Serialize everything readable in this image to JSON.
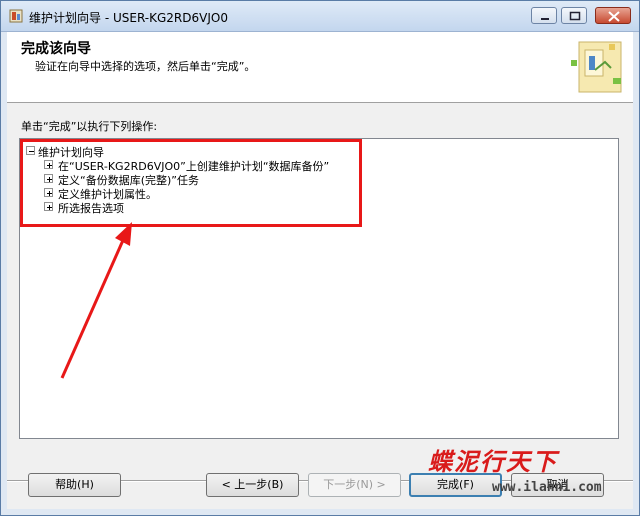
{
  "window": {
    "title": "维护计划向导 - USER-KG2RD6VJO0"
  },
  "header": {
    "title": "完成该向导",
    "subtitle": "验证在向导中选择的选项，然后单击“完成”。"
  },
  "instruction": "单击“完成”以执行下列操作:",
  "tree": {
    "root_label": "维护计划向导",
    "children": [
      {
        "label": "在“USER-KG2RD6VJO0”上创建维护计划“数据库备份”"
      },
      {
        "label": "定义“备份数据库(完整)”任务"
      },
      {
        "label": "定义维护计划属性。"
      },
      {
        "label": "所选报告选项"
      }
    ]
  },
  "buttons": {
    "help": "帮助(H)",
    "back": "< 上一步(B)",
    "next": "下一步(N) >",
    "finish": "完成(F)",
    "cancel": "取消"
  },
  "watermark": {
    "text": "蝶泥行天下",
    "url": "www.ilanni.com"
  },
  "colors": {
    "annotation": "#e81818",
    "default_button_border": "#3c7fb1"
  }
}
